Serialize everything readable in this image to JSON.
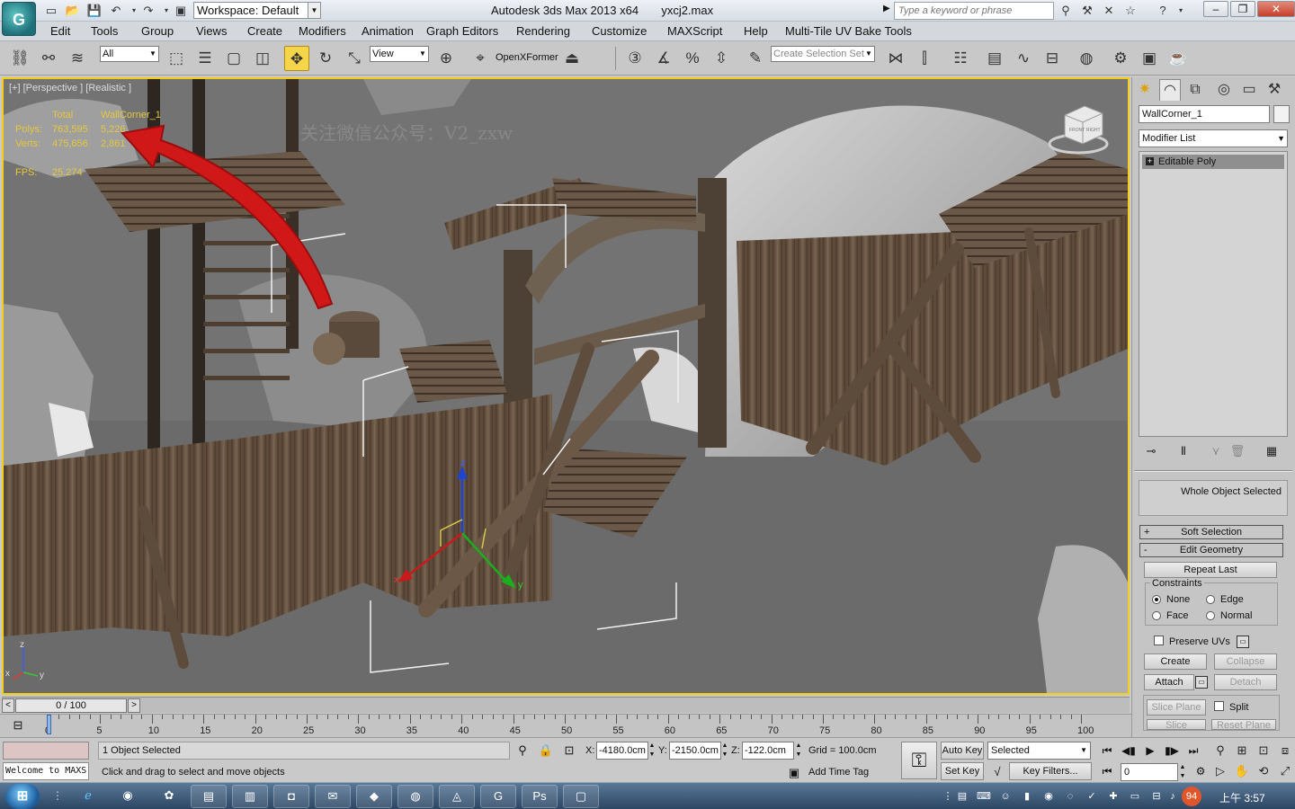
{
  "titlebar": {
    "workspace_label": "Workspace: Default",
    "app_title": "Autodesk 3ds Max  2013 x64",
    "file_name": "yxcj2.max",
    "search_placeholder": "Type a keyword or phrase"
  },
  "menu": [
    "Edit",
    "Tools",
    "Group",
    "Views",
    "Create",
    "Modifiers",
    "Animation",
    "Graph Editors",
    "Rendering",
    "Customize",
    "MAXScript",
    "Help",
    "Multi-Tile UV Bake Tools"
  ],
  "toolbar": {
    "filter_value": "All",
    "coord_system": "View",
    "openxformer_label": "OpenXFormer",
    "named_selection_placeholder": "Create Selection Set"
  },
  "viewport": {
    "label": "[+] [Perspective ] [Realistic ]",
    "stats": {
      "col_total": "Total",
      "col_object": "WallCorner_1",
      "polys_label": "Polys:",
      "polys_total": "763,595",
      "polys_object": "5,226",
      "verts_label": "Verts:",
      "verts_total": "475,656",
      "verts_object": "2,861",
      "fps_label": "FPS:",
      "fps_value": "25.274"
    },
    "watermark": "关注微信公众号：V2_zxw",
    "gizmo_labels": {
      "z": "z",
      "x": "x",
      "y": "y"
    },
    "corner_axis": {
      "x": "x",
      "y": "y",
      "z": "z"
    },
    "viewcube_labels": {
      "front": "FRONT",
      "right": "RIGHT"
    }
  },
  "command_panel": {
    "object_name": "WallCorner_1",
    "modifier_list": "Modifier List",
    "stack_item": "Editable Poly",
    "selection_info": "Whole Object Selected",
    "rollouts": {
      "soft_selection": "Soft Selection",
      "edit_geometry": "Edit Geometry"
    },
    "repeat_last": "Repeat Last",
    "constraints_title": "Constraints",
    "constraints": {
      "none": "None",
      "edge": "Edge",
      "face": "Face",
      "normal": "Normal"
    },
    "preserve_uvs": "Preserve UVs",
    "create": "Create",
    "collapse": "Collapse",
    "attach": "Attach",
    "detach": "Detach",
    "slice_plane": "Slice Plane",
    "split": "Split",
    "slice": "Slice",
    "reset_plane": "Reset Plane"
  },
  "timeline": {
    "position": "0 / 100",
    "prev": "<",
    "next": ">",
    "ticks": [
      "0",
      "5",
      "10",
      "15",
      "20",
      "25",
      "30",
      "35",
      "40",
      "45",
      "50",
      "55",
      "60",
      "65",
      "70",
      "75",
      "80",
      "85",
      "90",
      "95",
      "100"
    ]
  },
  "status": {
    "maxscript_text": "Welcome to MAXS",
    "selection": "1 Object Selected",
    "prompt": "Click and drag to select and move objects",
    "x_label": "X:",
    "x_value": "-4180.0cm",
    "y_label": "Y:",
    "y_value": "-2150.0cm",
    "z_label": "Z:",
    "z_value": "-122.0cm",
    "grid": "Grid = 100.0cm",
    "add_time_tag": "Add Time Tag",
    "auto_key": "Auto Key",
    "set_key": "Set Key",
    "key_set": "Selected",
    "key_filters": "Key Filters...",
    "frame": "0"
  },
  "taskbar": {
    "badge": "94",
    "clock": "上午 3:57"
  },
  "colors": {
    "viewport_border": "#f5cf17",
    "stat_text": "#e6c83a",
    "active_tool": "#f5d64a",
    "arrow_red": "#d11818"
  }
}
